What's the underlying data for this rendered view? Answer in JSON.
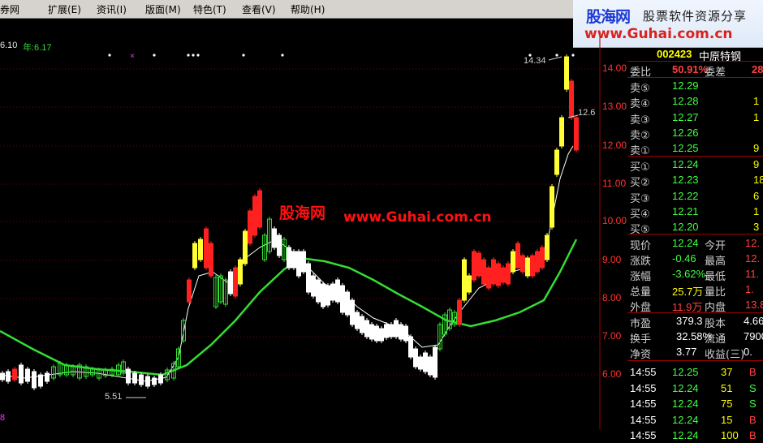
{
  "menu": {
    "items": [
      "券网",
      "扩展(E)",
      "资讯(I)",
      "版面(M)",
      "特色(T)",
      "查看(V)",
      "帮助(H)"
    ]
  },
  "banner": {
    "brand": "股海网",
    "tagline": "股票软件资源分享",
    "url": "www.Guhai.com.cn"
  },
  "chart": {
    "ma_labels": [
      "6.10",
      "年:6.17"
    ],
    "watermark_cn": "股海网",
    "watermark_url": "www.Guhai.com.cn",
    "high_label": "14.34",
    "low_label": "5.51",
    "last_label": "12.6",
    "bottom_label": "8",
    "y_ticks": [
      "14.00",
      "13.00",
      "12.00",
      "11.00",
      "10.00",
      "9.00",
      "8.00",
      "7.00",
      "6.00"
    ],
    "colors": {
      "up": "#ff2020",
      "down": "#ffffff",
      "highlight": "#ffff33",
      "green_line": "#33dd33",
      "white_line": "#ffffff",
      "dots": "#ffffff",
      "marker": "#ff33ff"
    }
  },
  "quote": {
    "code": "002423",
    "name": "中原特钢",
    "weibi_label": "委比",
    "weibi_value": "50.91%",
    "weicha_label": "委差",
    "weicha_value": "28",
    "sells": [
      {
        "label": "卖⑤",
        "price": "12.29",
        "vol": ""
      },
      {
        "label": "卖④",
        "price": "12.28",
        "vol": "1"
      },
      {
        "label": "卖③",
        "price": "12.27",
        "vol": "1"
      },
      {
        "label": "卖②",
        "price": "12.26",
        "vol": ""
      },
      {
        "label": "卖①",
        "price": "12.25",
        "vol": "9"
      }
    ],
    "buys": [
      {
        "label": "买①",
        "price": "12.24",
        "vol": "9"
      },
      {
        "label": "买②",
        "price": "12.23",
        "vol": "18"
      },
      {
        "label": "买③",
        "price": "12.22",
        "vol": "6"
      },
      {
        "label": "买④",
        "price": "12.21",
        "vol": "1"
      },
      {
        "label": "买⑤",
        "price": "12.20",
        "vol": "3"
      }
    ],
    "stats": [
      {
        "l1": "现价",
        "v1": "12.24",
        "c1": "grn",
        "l2": "今开",
        "v2": "12."
      },
      {
        "l1": "涨跌",
        "v1": "-0.46",
        "c1": "grn",
        "l2": "最高",
        "v2": "12."
      },
      {
        "l1": "涨幅",
        "v1": "-3.62%",
        "c1": "grn",
        "l2": "最低",
        "v2": "11."
      },
      {
        "l1": "总量",
        "v1": "25.7万",
        "c1": "yel",
        "l2": "量比",
        "v2": "1."
      },
      {
        "l1": "外盘",
        "v1": "11.9万",
        "c1": "red",
        "l2": "内盘",
        "v2": "13.8"
      }
    ],
    "stats2": [
      {
        "l1": "市盈",
        "v1": "379.3",
        "l2": "股本",
        "v2": "4.66"
      },
      {
        "l1": "换手",
        "v1": "32.58%",
        "l2": "流通",
        "v2": "7900"
      },
      {
        "l1": "净资",
        "v1": "3.77",
        "l2": "收益(三)",
        "v2": "0."
      }
    ],
    "ticks": [
      {
        "time": "14:55",
        "price": "12.25",
        "vol": "37",
        "side": "B"
      },
      {
        "time": "14:55",
        "price": "12.24",
        "vol": "51",
        "side": "S"
      },
      {
        "time": "14:55",
        "price": "12.24",
        "vol": "75",
        "side": "S"
      },
      {
        "time": "14:55",
        "price": "12.24",
        "vol": "15",
        "side": "B"
      },
      {
        "time": "14:55",
        "price": "12.24",
        "vol": "100",
        "side": "B"
      }
    ]
  }
}
